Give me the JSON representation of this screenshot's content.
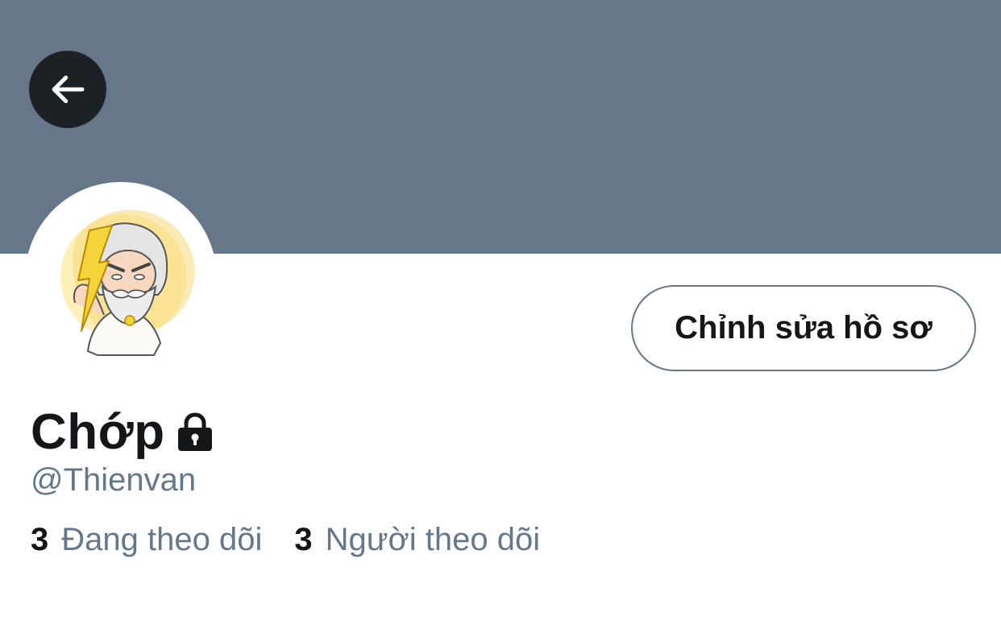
{
  "profile": {
    "display_name": "Chớp",
    "handle": "@Thienvan",
    "banner_color": "#66778a",
    "protected_icon": "lock-icon"
  },
  "header": {
    "back_icon": "arrow-left-icon"
  },
  "actions": {
    "edit_profile_label": "Chỉnh sửa hồ sơ"
  },
  "stats": {
    "following_count": "3",
    "following_label": "Đang theo dõi",
    "followers_count": "3",
    "followers_label": "Người theo dõi"
  },
  "colors": {
    "text_primary": "#14171a",
    "text_secondary": "#66778a",
    "back_button_bg": "#1c2126"
  }
}
